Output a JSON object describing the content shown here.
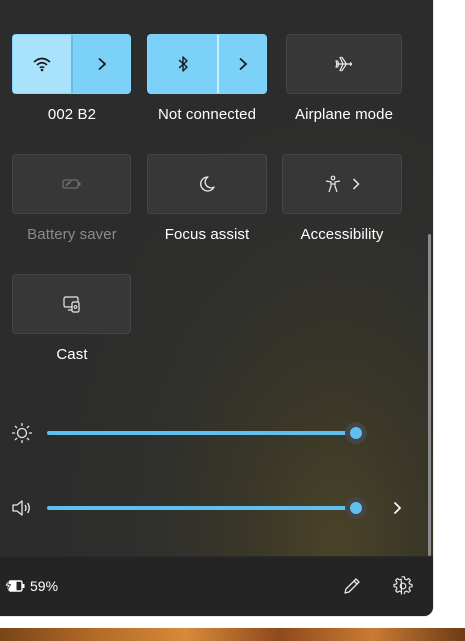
{
  "quick_settings": {
    "tiles": [
      {
        "label": "002 B2",
        "state": "on",
        "icon": "wifi-icon",
        "has_arrow": true
      },
      {
        "label": "Not connected",
        "state": "on",
        "icon": "bluetooth-icon",
        "has_arrow": true
      },
      {
        "label": "Airplane mode",
        "state": "off",
        "icon": "airplane-icon",
        "has_arrow": false
      },
      {
        "label": "Battery saver",
        "state": "disabled",
        "icon": "battery-saver-icon",
        "has_arrow": false
      },
      {
        "label": "Focus assist",
        "state": "off",
        "icon": "moon-icon",
        "has_arrow": false
      },
      {
        "label": "Accessibility",
        "state": "off",
        "icon": "accessibility-icon",
        "has_arrow": true
      },
      {
        "label": "Cast",
        "state": "off",
        "icon": "cast-icon",
        "has_arrow": false
      }
    ],
    "brightness": {
      "icon": "brightness-icon",
      "value_fraction": 0.96
    },
    "volume": {
      "icon": "speaker-icon",
      "value_fraction": 0.96,
      "has_arrow": true
    }
  },
  "footer": {
    "battery_percent": "59%",
    "battery_icon": "battery-charging-icon",
    "edit_icon": "pencil-icon",
    "settings_icon": "gear-icon"
  },
  "colors": {
    "accent": "#7cd1f8",
    "accent_light": "#a9e2fb",
    "slider": "#5fbfef",
    "panel": "#2c2c2c",
    "footer": "#242424"
  }
}
